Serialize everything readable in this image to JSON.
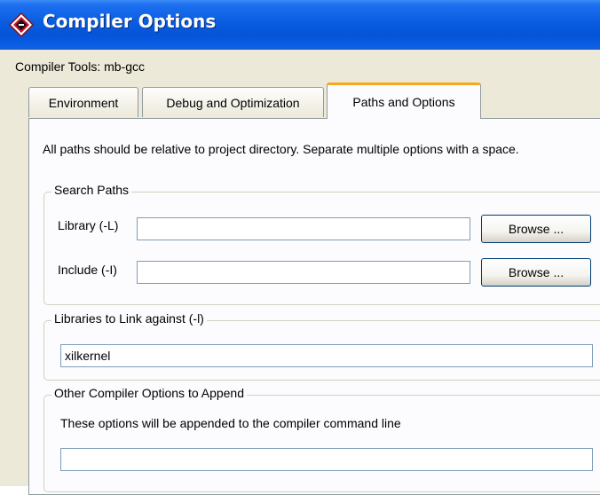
{
  "window": {
    "title": "Compiler Options",
    "title_icon": "xilinx-app-icon"
  },
  "tools": {
    "label": "Compiler Tools: mb-gcc"
  },
  "tabs": [
    {
      "label": "Environment",
      "selected": false
    },
    {
      "label": "Debug and Optimization",
      "selected": false
    },
    {
      "label": "Paths and Options",
      "selected": true
    }
  ],
  "intro_text": "All paths should be relative to project directory. Separate multiple options with a space.",
  "search_paths": {
    "legend": "Search Paths",
    "library": {
      "label": "Library (-L)",
      "value": "",
      "browse_label": "Browse ..."
    },
    "include": {
      "label": "Include (-I)",
      "value": "",
      "browse_label": "Browse ..."
    }
  },
  "libraries": {
    "legend": "Libraries to Link against (-l)",
    "value": "xilkernel"
  },
  "other_options": {
    "legend": "Other Compiler Options to Append",
    "note": "These options will be appended to the compiler command line",
    "value": ""
  },
  "colors": {
    "title_bar": "#0553d8",
    "dialog_bg": "#ece9d8",
    "panel_bg": "#fcfcfe",
    "tab_highlight": "#f7a81e",
    "input_border": "#7f9db9",
    "button_border": "#003c74"
  }
}
